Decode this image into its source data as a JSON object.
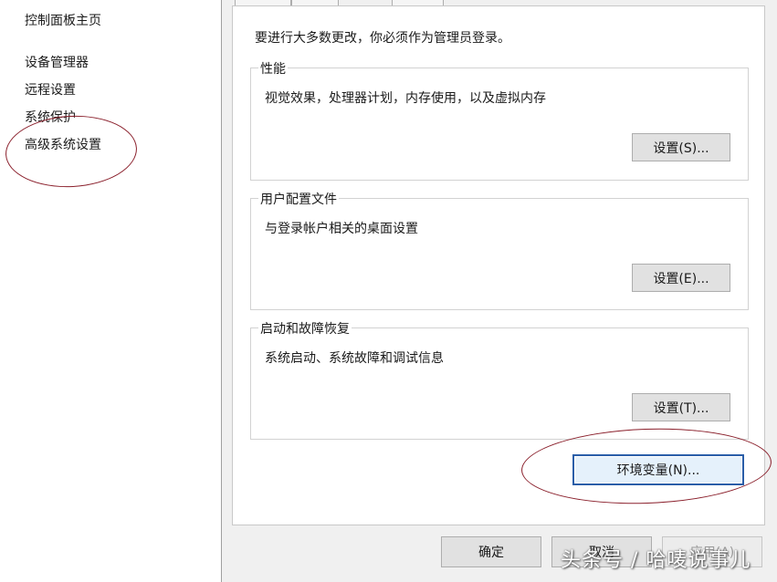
{
  "sidebar": {
    "control_panel_home": "控制面板主页",
    "items": [
      {
        "label": "设备管理器"
      },
      {
        "label": "远程设置"
      },
      {
        "label": "系统保护"
      },
      {
        "label": "高级系统设置"
      }
    ]
  },
  "dialog": {
    "admin_notice": "要进行大多数更改，你必须作为管理员登录。",
    "performance": {
      "title": "性能",
      "description": "视觉效果，处理器计划，内存使用，以及虚拟内存",
      "button": "设置(S)..."
    },
    "user_profiles": {
      "title": "用户配置文件",
      "description": "与登录帐户相关的桌面设置",
      "button": "设置(E)..."
    },
    "startup_recovery": {
      "title": "启动和故障恢复",
      "description": "系统启动、系统故障和调试信息",
      "button": "设置(T)..."
    },
    "env_vars_button": "环境变量(N)...",
    "ok_button": "确定",
    "cancel_button": "取消",
    "apply_button": "应用(A)"
  },
  "annotation_color": "#8a1f2b",
  "focus_color": "#2a5ea8",
  "watermark": "头条号 / 哈唛说事儿"
}
